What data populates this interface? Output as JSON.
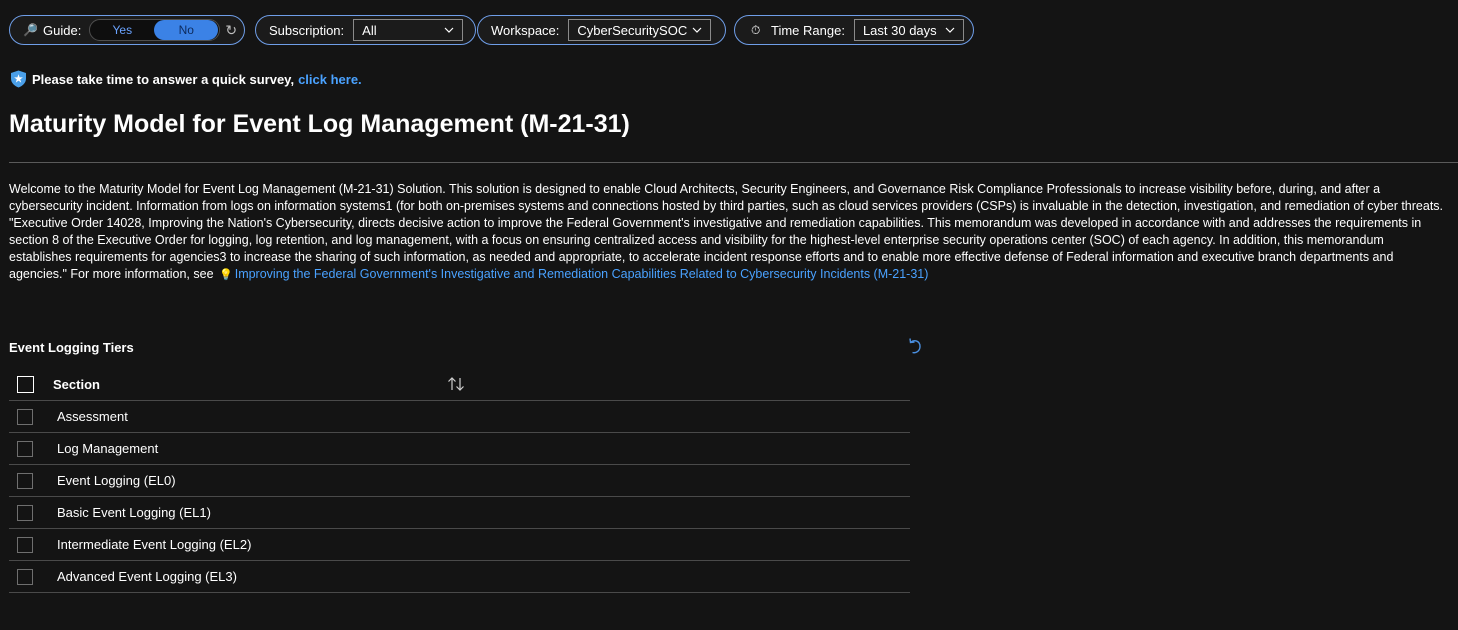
{
  "toolbar": {
    "guide": {
      "label": "Guide:",
      "icon": "magnifier-icon",
      "options": [
        "Yes",
        "No"
      ],
      "selected": "No"
    },
    "subscription": {
      "label": "Subscription:",
      "value": "All"
    },
    "workspace": {
      "label": "Workspace:",
      "value": "CyberSecuritySOC"
    },
    "time_range": {
      "label": "Time Range:",
      "value": "Last 30 days",
      "icon": "stopwatch-icon"
    }
  },
  "survey": {
    "text": "Please take time to answer a quick survey,",
    "link": "click here."
  },
  "page": {
    "title": "Maturity Model for Event Log Management (M-21-31)"
  },
  "description": {
    "text": "Welcome to the Maturity Model for Event Log Management (M-21-31) Solution. This solution is designed to enable Cloud Architects, Security Engineers, and Governance Risk Compliance Professionals to increase visibility before, during, and after a cybersecurity incident. Information from logs on information systems1 (for both on-premises systems and connections hosted by third parties, such as cloud services providers (CSPs) is invaluable in the detection, investigation, and remediation of cyber threats. \"Executive Order 14028, Improving the Nation's Cybersecurity, directs decisive action to improve the Federal Government's investigative and remediation capabilities. This memorandum was developed in accordance with and addresses the requirements in section 8 of the Executive Order for logging, log retention, and log management, with a focus on ensuring centralized access and visibility for the highest-level enterprise security operations center (SOC) of each agency. In addition, this memorandum establishes requirements for agencies3 to increase the sharing of such information, as needed and appropriate, to accelerate incident response efforts and to enable more effective defense of Federal information and executive branch departments and agencies.\" For more information, see",
    "link": "Improving the Federal Government's Investigative and Remediation Capabilities Related to Cybersecurity Incidents (M-21-31)"
  },
  "grid": {
    "title": "Event Logging Tiers",
    "column": "Section",
    "rows": [
      "Assessment",
      "Log Management",
      "Event Logging (EL0)",
      "Basic Event Logging (EL1)",
      "Intermediate Event Logging (EL2)",
      "Advanced Event Logging (EL3)"
    ]
  },
  "colors": {
    "background": "#141414",
    "accent": "#6f9ee8",
    "link": "#4aa2ff",
    "toggle_selected": "#3b82e6"
  }
}
